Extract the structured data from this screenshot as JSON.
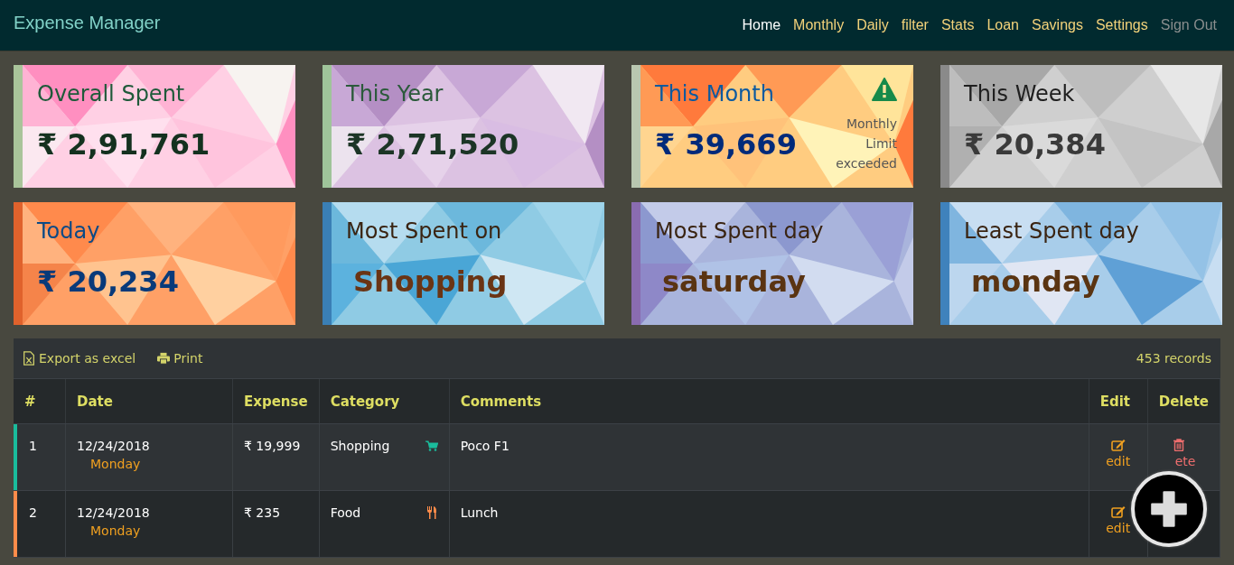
{
  "navbar": {
    "brand": "Expense Manager",
    "links": [
      {
        "label": "Home",
        "selected": true,
        "disabled": false
      },
      {
        "label": "Monthly",
        "selected": false,
        "disabled": false
      },
      {
        "label": "Daily",
        "selected": false,
        "disabled": false
      },
      {
        "label": "filter",
        "selected": false,
        "disabled": false
      },
      {
        "label": "Stats",
        "selected": false,
        "disabled": false
      },
      {
        "label": "Loan",
        "selected": false,
        "disabled": false
      },
      {
        "label": "Savings",
        "selected": false,
        "disabled": false
      },
      {
        "label": "Settings",
        "selected": false,
        "disabled": false
      },
      {
        "label": "Sign Out",
        "selected": false,
        "disabled": true
      }
    ]
  },
  "cards": [
    {
      "title": "Overall Spent",
      "value": "₹ 2,91,761",
      "kind": "pink"
    },
    {
      "title": "This Year",
      "value": "₹ 2,71,520",
      "kind": "purple"
    },
    {
      "title": "This Month",
      "value": "₹ 39,669",
      "kind": "orange",
      "alert": "Monthly Limit exceeded"
    },
    {
      "title": "This Week",
      "value": "₹ 20,384",
      "kind": "grey"
    },
    {
      "title": "Today",
      "value": "₹ 20,234",
      "kind": "peach"
    },
    {
      "title": "Most Spent on",
      "value": "Shopping",
      "kind": "blue"
    },
    {
      "title": "Most Spent day",
      "value": "saturday",
      "kind": "violet"
    },
    {
      "title": "Least Spent day",
      "value": "monday",
      "kind": "sky"
    }
  ],
  "table": {
    "toolbar": {
      "export": "Export as excel",
      "print": "Print",
      "count": "453 records"
    },
    "columns": [
      "#",
      "Date",
      "Expense",
      "Category",
      "Comments",
      "Edit",
      "Delete"
    ],
    "rows": [
      {
        "index": "1",
        "date": "12/24/2018",
        "day": "Monday",
        "expense": "₹ 19,999",
        "category": {
          "label": "Shopping",
          "kind": "cart"
        },
        "comments": "Poco F1",
        "edit": "edit",
        "delete": "ete",
        "color": "#1abc9c"
      },
      {
        "index": "2",
        "date": "12/24/2018",
        "day": "Monday",
        "expense": "₹ 235",
        "category": {
          "label": "Food",
          "kind": "food"
        },
        "comments": "Lunch",
        "edit": "edit",
        "color": "#ff8c4a"
      }
    ]
  },
  "add_button": {
    "kind": "plus"
  }
}
